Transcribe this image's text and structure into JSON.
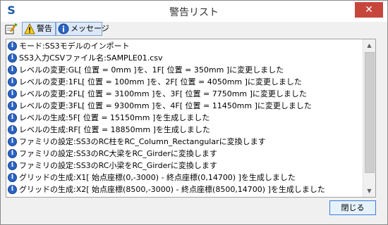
{
  "window": {
    "title": "警告リスト",
    "app_icon_letter": "S",
    "close_glyph": "✕"
  },
  "toolbar": {
    "tabs": [
      {
        "label": "警告",
        "icon": "warning-icon"
      },
      {
        "label": "メッセージ",
        "icon": "info-icon"
      }
    ]
  },
  "messages": [
    "モード:SS3モデルのインポート",
    "SS3入力CSVファイル名:SAMPLE01.csv",
    "レベルの変更:GL[ 位置 = 0mm ]を、1F[ 位置 = 350mm ]に変更しました",
    "レベルの変更:1FL[ 位置 = 100mm ]を、2F[ 位置 = 4050mm ]に変更しました",
    "レベルの変更:2FL[ 位置 = 3100mm ]を、3F[ 位置 = 7750mm ]に変更しました",
    "レベルの変更:3FL[ 位置 = 9300mm ]を、4F[ 位置 = 11450mm ]に変更しました",
    "レベルの生成:5F[ 位置 = 15150mm ]を生成しました",
    "レベルの生成:RF[ 位置 = 18850mm ]を生成しました",
    "ファミリの設定:SS3のRC柱をRC_Column_Rectangularに変換します",
    "ファミリの設定:SS3のRC大梁をRC_Girderに変換します",
    "ファミリの設定:SS3のRC小梁をRC_Girderに変換します",
    "グリッドの生成:X1[ 始点座標(0,-3000) - 終点座標(0,14700) ]を生成しました",
    "グリッドの生成:X2[ 始点座標(8500,-3000) - 終点座標(8500,14700) ]を生成しました"
  ],
  "buttons": {
    "close_label": "閉じる"
  }
}
